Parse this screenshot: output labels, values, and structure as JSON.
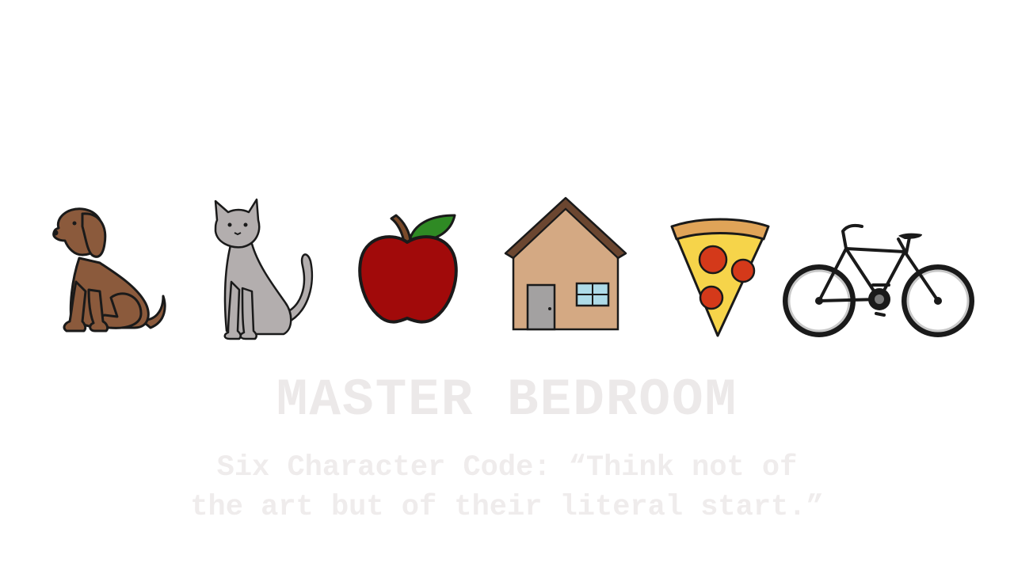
{
  "room": {
    "title": "MASTER BEDROOM",
    "clue_line_1": "Six Character Code: “Think not of",
    "clue_line_2": "the art but of their literal start.”"
  },
  "icons": [
    {
      "id": "dog",
      "icon": "dog-icon"
    },
    {
      "id": "cat",
      "icon": "cat-icon"
    },
    {
      "id": "apple",
      "icon": "apple-icon"
    },
    {
      "id": "house",
      "icon": "house-icon"
    },
    {
      "id": "pizza",
      "icon": "pizza-icon"
    },
    {
      "id": "bike",
      "icon": "bicycle-icon"
    }
  ],
  "colors": {
    "dog": "#8b5a3c",
    "cat": "#b3aeae",
    "apple": "#a10a0a",
    "leaf": "#2f8a24",
    "house_wall": "#d4a983",
    "roof": "#6b4630",
    "pizza_cheese": "#f6d44a",
    "pepperoni": "#d4391a",
    "crust": "#e0a458",
    "text_faint": "#ece9e9"
  }
}
